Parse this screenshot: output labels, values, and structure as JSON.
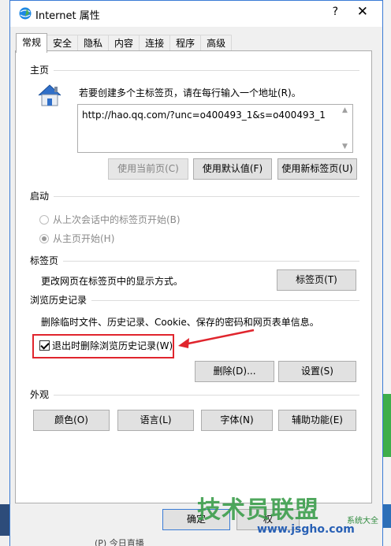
{
  "window": {
    "title": "Internet 属性",
    "help": "?",
    "close": "✕"
  },
  "tabs": [
    "常规",
    "安全",
    "隐私",
    "内容",
    "连接",
    "程序",
    "高级"
  ],
  "homepage": {
    "section": "主页",
    "hint": "若要创建多个主标签页，请在每行输入一个地址(R)。",
    "url": "http://hao.qq.com/?unc=o400493_1&s=o400493_1",
    "btn_current": "使用当前页(C)",
    "btn_default": "使用默认值(F)",
    "btn_newtab": "使用新标签页(U)"
  },
  "startup": {
    "section": "启动",
    "option_last": "从上次会话中的标签页开始(B)",
    "option_home": "从主页开始(H)"
  },
  "tabs_section": {
    "section": "标签页",
    "desc": "更改网页在标签页中的显示方式。",
    "btn": "标签页(T)"
  },
  "history": {
    "section": "浏览历史记录",
    "desc": "删除临时文件、历史记录、Cookie、保存的密码和网页表单信息。",
    "checkbox": "退出时删除浏览历史记录(W)",
    "btn_delete": "删除(D)...",
    "btn_settings": "设置(S)"
  },
  "appearance": {
    "section": "外观",
    "btn_colors": "颜色(O)",
    "btn_languages": "语言(L)",
    "btn_fonts": "字体(N)",
    "btn_accessibility": "辅助功能(E)"
  },
  "footer": {
    "ok": "确定",
    "partial": "权"
  },
  "watermark": {
    "brand": "技术员联盟",
    "url": "www.jsgho.com",
    "sub": "系统大全"
  },
  "taskbar": {
    "text": "(P) 今日直播"
  },
  "colors": {
    "highlight": "#e0252d",
    "accent": "#3a7bd5"
  }
}
